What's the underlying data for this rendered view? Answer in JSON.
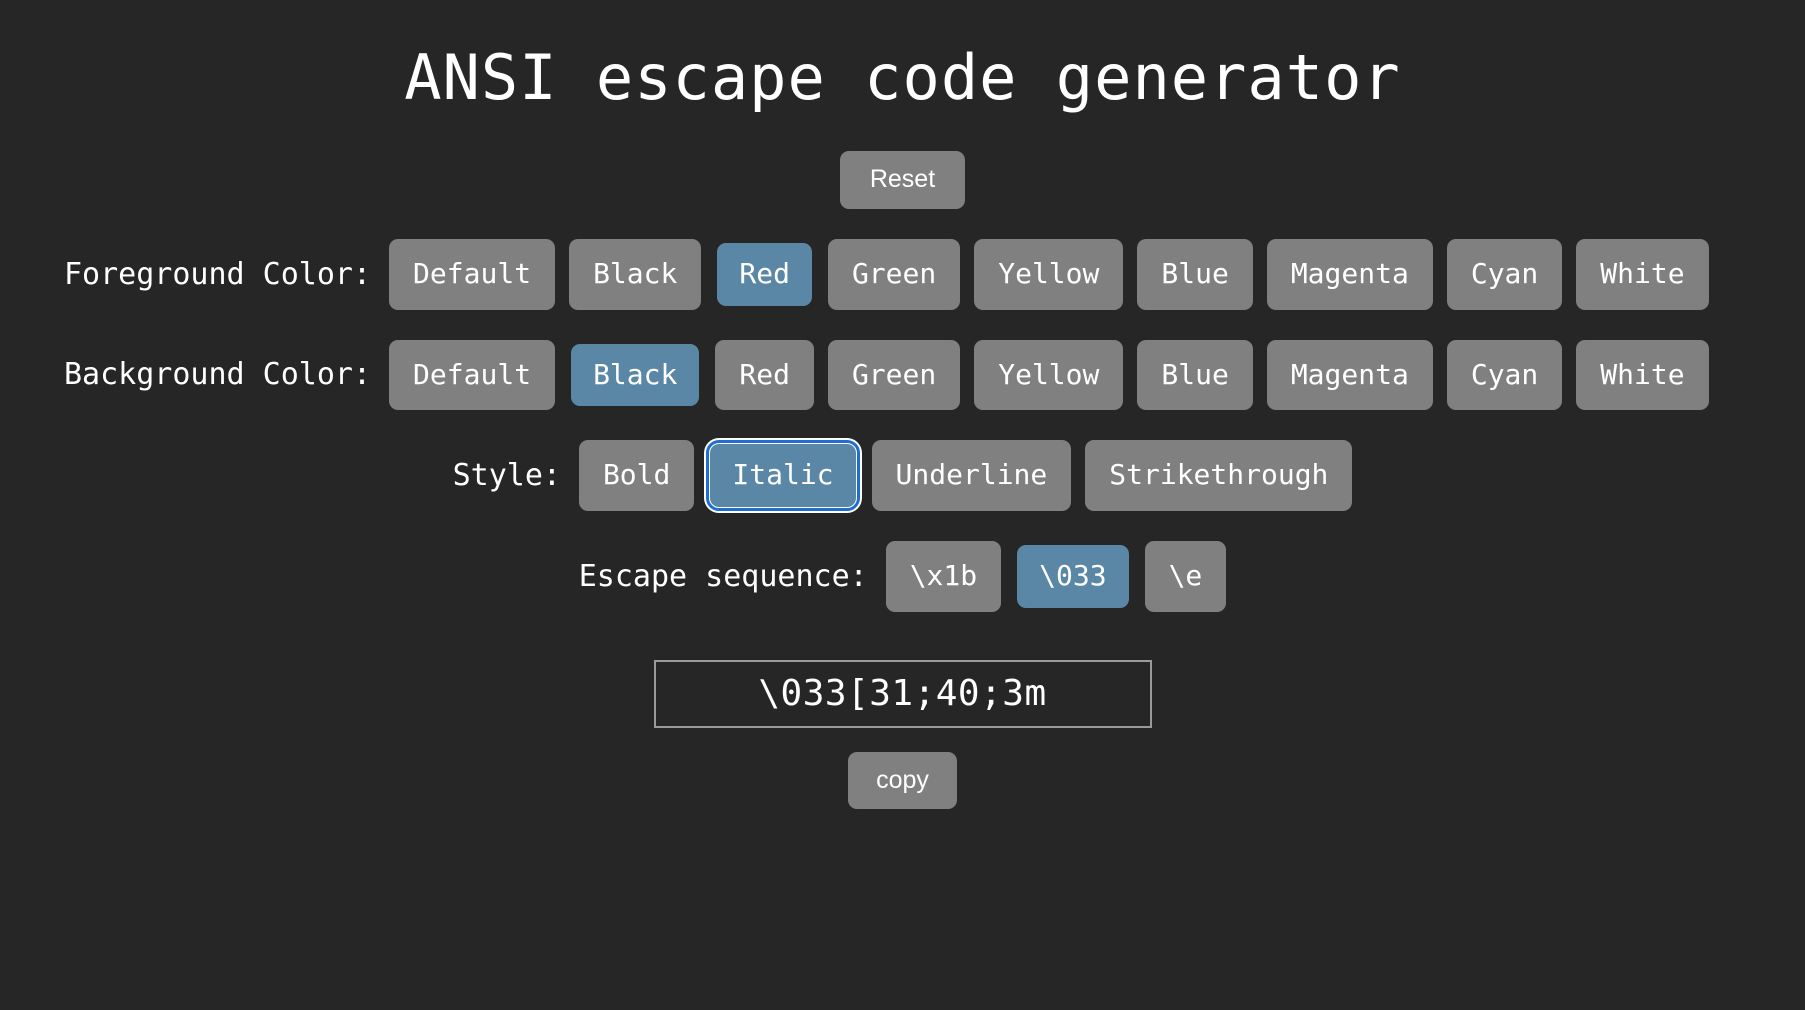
{
  "theme": {
    "background": "#262626",
    "button_bg": "#808080",
    "button_selected_bg": "#5b87a6",
    "focus_ring_inner": "#1f6fd0",
    "focus_ring_outer": "#ffffff",
    "text": "#ffffff",
    "output_border": "#9a9a9a"
  },
  "header": {
    "title": "ANSI escape code generator"
  },
  "toolbar": {
    "reset_label": "Reset"
  },
  "foreground": {
    "label": "Foreground Color:",
    "selected": "Red",
    "options": [
      {
        "label": "Default",
        "selected": false
      },
      {
        "label": "Black",
        "selected": false
      },
      {
        "label": "Red",
        "selected": true
      },
      {
        "label": "Green",
        "selected": false
      },
      {
        "label": "Yellow",
        "selected": false
      },
      {
        "label": "Blue",
        "selected": false
      },
      {
        "label": "Magenta",
        "selected": false
      },
      {
        "label": "Cyan",
        "selected": false
      },
      {
        "label": "White",
        "selected": false
      }
    ]
  },
  "background": {
    "label": "Background Color:",
    "selected": "Black",
    "options": [
      {
        "label": "Default",
        "selected": false
      },
      {
        "label": "Black",
        "selected": true
      },
      {
        "label": "Red",
        "selected": false
      },
      {
        "label": "Green",
        "selected": false
      },
      {
        "label": "Yellow",
        "selected": false
      },
      {
        "label": "Blue",
        "selected": false
      },
      {
        "label": "Magenta",
        "selected": false
      },
      {
        "label": "Cyan",
        "selected": false
      },
      {
        "label": "White",
        "selected": false
      }
    ]
  },
  "style": {
    "label": "Style:",
    "selected": "Italic",
    "options": [
      {
        "label": "Bold",
        "selected": false,
        "focused": false
      },
      {
        "label": "Italic",
        "selected": true,
        "focused": true
      },
      {
        "label": "Underline",
        "selected": false,
        "focused": false
      },
      {
        "label": "Strikethrough",
        "selected": false,
        "focused": false
      }
    ]
  },
  "escape_sequence": {
    "label": "Escape sequence:",
    "selected": "\\033",
    "options": [
      {
        "label": "\\x1b",
        "selected": false
      },
      {
        "label": "\\033",
        "selected": true
      },
      {
        "label": "\\e",
        "selected": false
      }
    ]
  },
  "output": {
    "value": "\\033[31;40;3m",
    "copy_label": "copy"
  }
}
